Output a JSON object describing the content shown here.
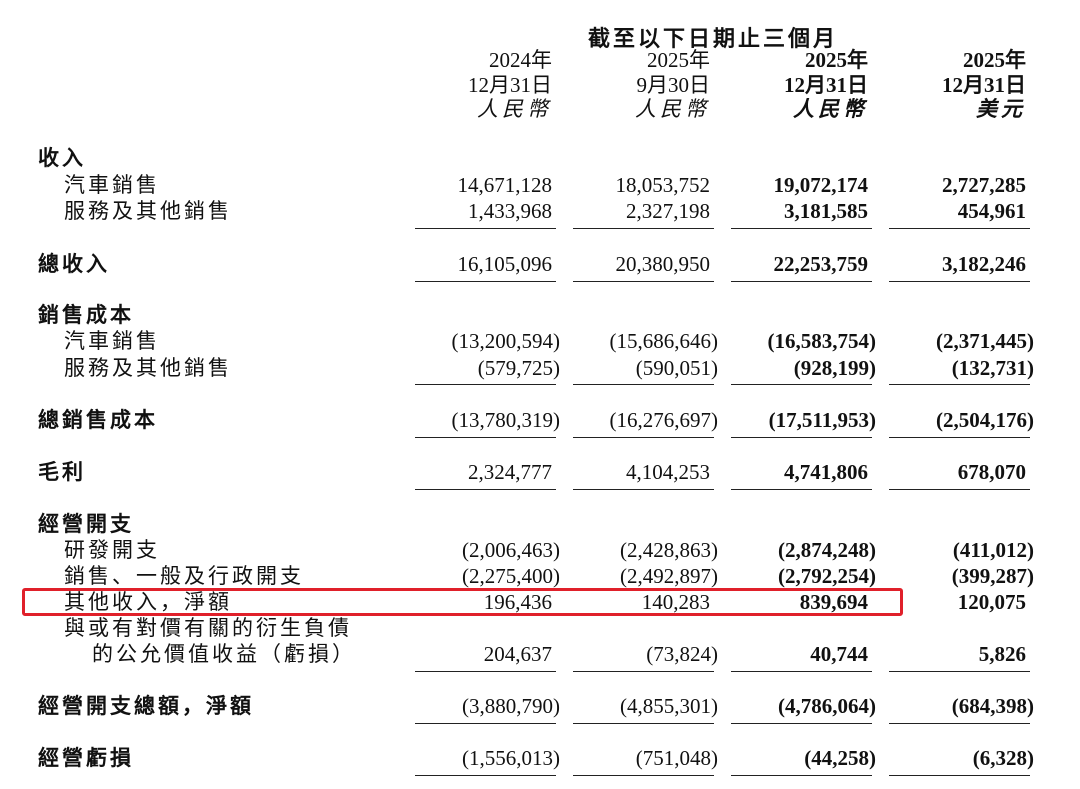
{
  "header": {
    "period_span": "截至以下日期止三個月",
    "columns": [
      {
        "year": "2024年",
        "date": "12月31日",
        "currency": "人民幣"
      },
      {
        "year": "2025年",
        "date": "9月30日",
        "currency": "人民幣"
      },
      {
        "year": "2025年",
        "date": "12月31日",
        "currency": "人民幣"
      },
      {
        "year": "2025年",
        "date": "12月31日",
        "currency": "美元"
      }
    ]
  },
  "rows": {
    "revenue_heading": "收入",
    "vehicle_sales": {
      "label": "汽車銷售",
      "v": [
        "14,671,128",
        "18,053,752",
        "19,072,174",
        "2,727,285"
      ]
    },
    "services_sales": {
      "label": "服務及其他銷售",
      "v": [
        "1,433,968",
        "2,327,198",
        "3,181,585",
        "454,961"
      ]
    },
    "total_revenue": {
      "label": "總收入",
      "v": [
        "16,105,096",
        "20,380,950",
        "22,253,759",
        "3,182,246"
      ]
    },
    "cost_heading": "銷售成本",
    "cost_vehicle": {
      "label": "汽車銷售",
      "v": [
        "(13,200,594)",
        "(15,686,646)",
        "(16,583,754)",
        "(2,371,445)"
      ]
    },
    "cost_services": {
      "label": "服務及其他銷售",
      "v": [
        "(579,725)",
        "(590,051)",
        "(928,199)",
        "(132,731)"
      ]
    },
    "total_cost": {
      "label": "總銷售成本",
      "v": [
        "(13,780,319)",
        "(16,276,697)",
        "(17,511,953)",
        "(2,504,176)"
      ]
    },
    "gross_profit": {
      "label": "毛利",
      "v": [
        "2,324,777",
        "4,104,253",
        "4,741,806",
        "678,070"
      ]
    },
    "opex_heading": "經營開支",
    "rnd": {
      "label": "研發開支",
      "v": [
        "(2,006,463)",
        "(2,428,863)",
        "(2,874,248)",
        "(411,012)"
      ]
    },
    "sga": {
      "label": "銷售、一般及行政開支",
      "v": [
        "(2,275,400)",
        "(2,492,897)",
        "(2,792,254)",
        "(399,287)"
      ]
    },
    "other_income": {
      "label": "其他收入，淨額",
      "v": [
        "196,436",
        "140,283",
        "839,694",
        "120,075"
      ]
    },
    "derivative": {
      "label1": "與或有對價有關的衍生負債",
      "label2": "的公允價值收益（虧損）",
      "v": [
        "204,637",
        "(73,824)",
        "40,744",
        "5,826"
      ]
    },
    "total_opex": {
      "label": "經營開支總額，淨額",
      "v": [
        "(3,880,790)",
        "(4,855,301)",
        "(4,786,064)",
        "(684,398)"
      ]
    },
    "operating_loss": {
      "label": "經營虧損",
      "v": [
        "(1,556,013)",
        "(751,048)",
        "(44,258)",
        "(6,328)"
      ]
    }
  },
  "highlight_color": "#e0202a"
}
